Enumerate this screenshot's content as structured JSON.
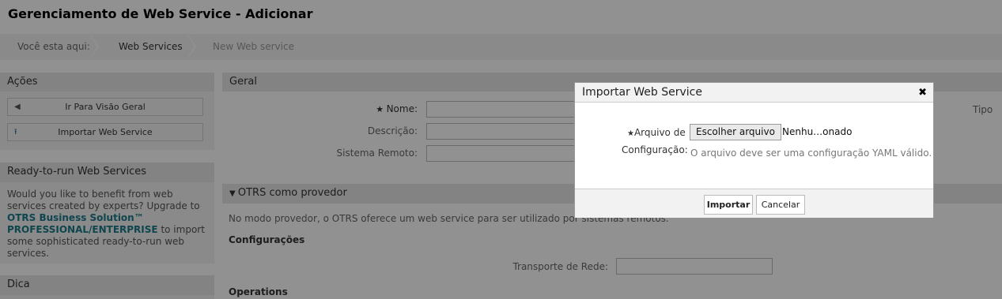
{
  "page_title": "Gerenciamento de Web Service - Adicionar",
  "breadcrumb": {
    "items": [
      "Você esta aqui:",
      "Web Services",
      "New Web service"
    ]
  },
  "sidebar": {
    "actions": {
      "title": "Ações",
      "buttons": [
        {
          "label": "Ir Para Visão Geral",
          "icon": "caret-left-icon"
        },
        {
          "label": "Importar Web Service",
          "icon": "upload-icon"
        }
      ]
    },
    "ready_to_run": {
      "title": "Ready-to-run Web Services",
      "text_before": "Would you like to benefit from web services created by experts? Upgrade to",
      "link": "OTRS Business Solution™ PROFESSIONAL/ENTERPRISE",
      "text_after": "to import some sophisticated ready-to-run web services."
    },
    "tip": {
      "title": "Dica"
    }
  },
  "main": {
    "general": {
      "title": "Geral",
      "name_label": "Nome:",
      "description_label": "Descrição:",
      "remote_system_label": "Sistema Remoto:",
      "type_label": "Tipo"
    },
    "provider": {
      "title": "OTRS como provedor",
      "description": "No modo provedor, o OTRS oferece um web service para ser utilizado por sistemas remotos.",
      "config_heading": "Configurações",
      "transport_label": "Transporte de Rede:",
      "operations_heading": "Operations"
    }
  },
  "dialog": {
    "title": "Importar Web Service",
    "label_line1": "Arquivo de",
    "label_line2": "Configuração:",
    "file_button": "Escolher arquivo",
    "file_status": "Nenhu…onado",
    "hint": "O arquivo deve ser uma configuração YAML válido.",
    "import_button": "Importar",
    "cancel_button": "Cancelar"
  }
}
